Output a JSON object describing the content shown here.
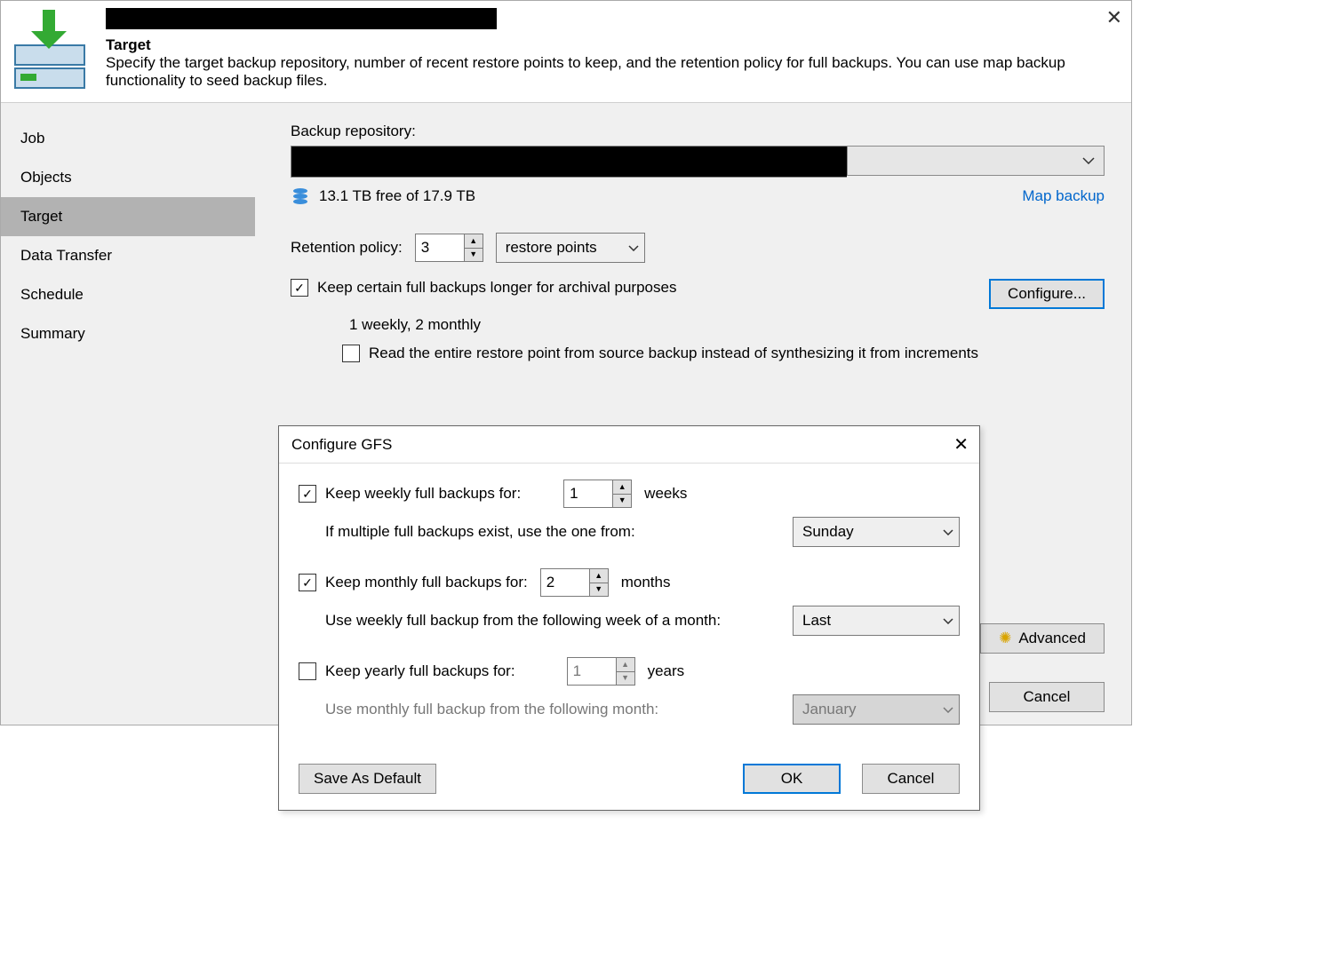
{
  "header": {
    "title": "Target",
    "description": "Specify the target backup repository, number of recent restore points to keep, and the retention policy for full backups. You can use map backup functionality to seed backup files."
  },
  "sidebar": {
    "items": [
      {
        "label": "Job"
      },
      {
        "label": "Objects"
      },
      {
        "label": "Target",
        "selected": true
      },
      {
        "label": "Data Transfer"
      },
      {
        "label": "Schedule"
      },
      {
        "label": "Summary"
      }
    ]
  },
  "content": {
    "repo_label": "Backup repository:",
    "free_space": "13.1 TB free of 17.9 TB",
    "map_backup": "Map backup",
    "retention_label": "Retention policy:",
    "retention_value": "3",
    "retention_unit": "restore points",
    "keep_full_label": "Keep certain full backups longer for archival purposes",
    "keep_full_checked": true,
    "gfs_summary": "1 weekly, 2 monthly",
    "configure_btn": "Configure...",
    "read_entire_label": "Read the entire restore point from source backup instead of synthesizing it from increments",
    "read_entire_checked": false,
    "advanced_btn": "Advanced",
    "cancel_btn": "Cancel"
  },
  "modal": {
    "title": "Configure GFS",
    "weekly": {
      "checked": true,
      "label": "Keep weekly full backups for:",
      "value": "1",
      "unit": "weeks",
      "sub_label": "If multiple full backups exist, use the one from:",
      "day": "Sunday"
    },
    "monthly": {
      "checked": true,
      "label": "Keep monthly full backups for:",
      "value": "2",
      "unit": "months",
      "sub_label": "Use weekly full backup from the following week of a month:",
      "week": "Last"
    },
    "yearly": {
      "checked": false,
      "label": "Keep yearly full backups for:",
      "value": "1",
      "unit": "years",
      "sub_label": "Use monthly full backup from the following month:",
      "month": "January"
    },
    "save_default": "Save As Default",
    "ok": "OK",
    "cancel": "Cancel"
  }
}
